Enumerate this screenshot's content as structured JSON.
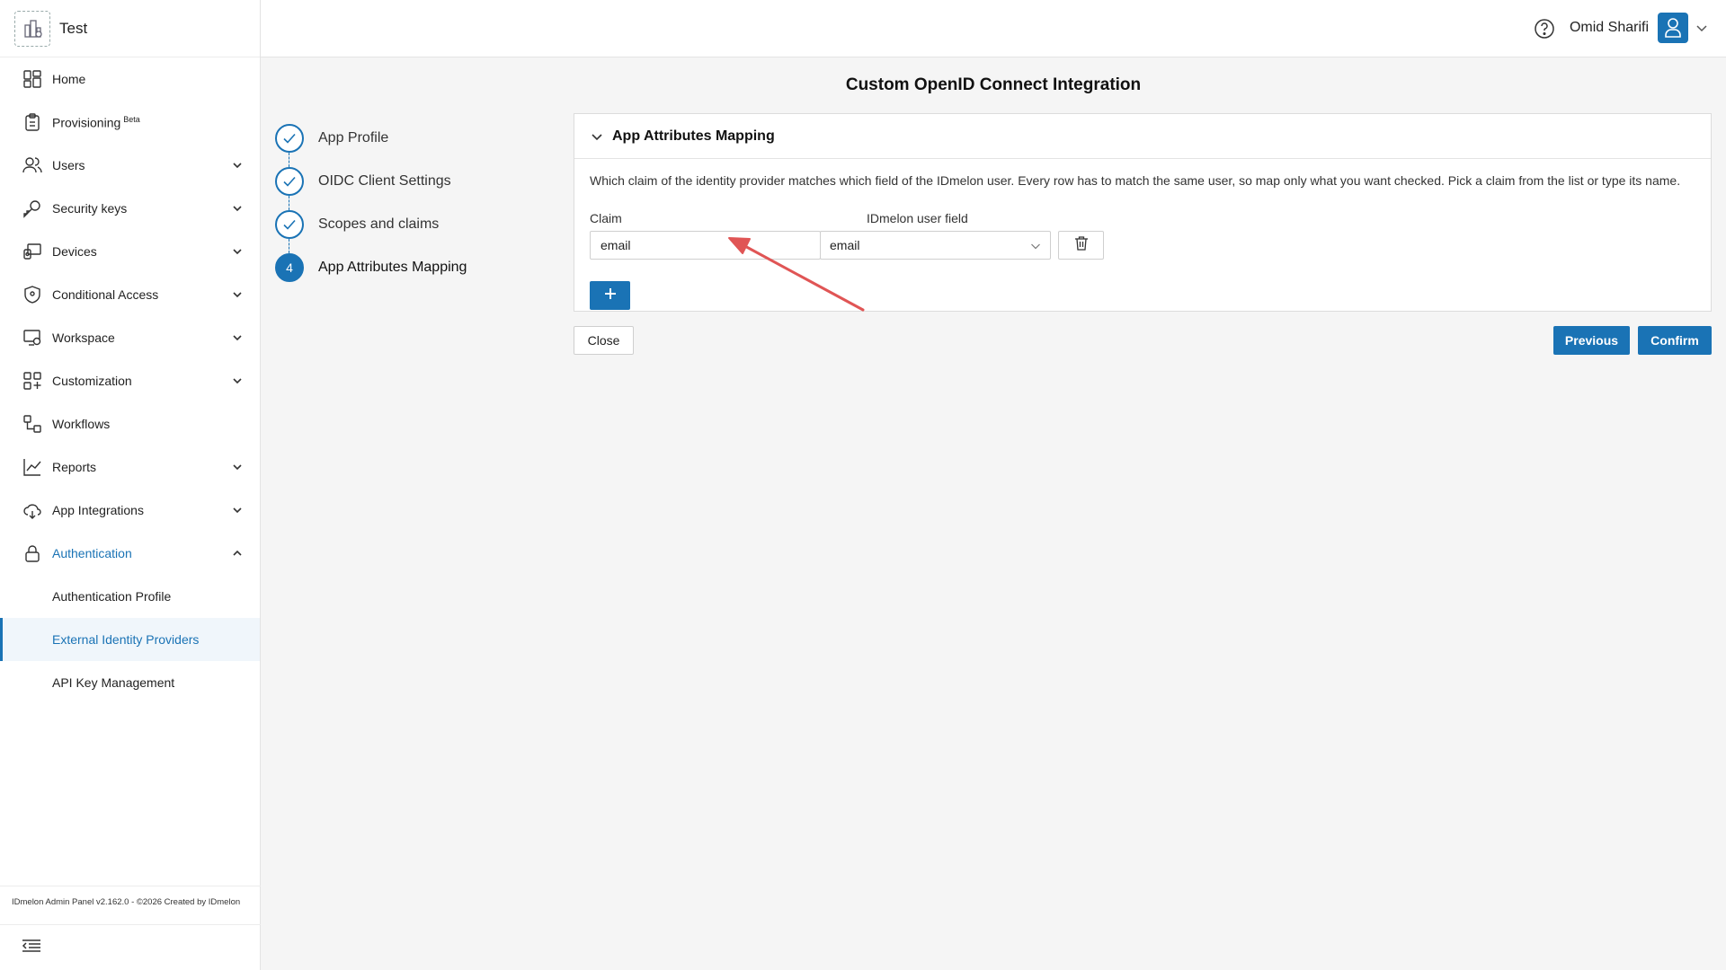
{
  "app": {
    "tenant_name": "Test"
  },
  "header": {
    "user_name": "Omid Sharifi"
  },
  "sidebar": {
    "items": [
      {
        "label": "Home",
        "icon": "home-grid-icon"
      },
      {
        "label": "Provisioning",
        "badge": "Beta",
        "icon": "clipboard-icon"
      },
      {
        "label": "Users",
        "icon": "users-icon"
      },
      {
        "label": "Security keys",
        "icon": "key-icon"
      },
      {
        "label": "Devices",
        "icon": "devices-icon"
      },
      {
        "label": "Conditional Access",
        "icon": "shield-icon"
      },
      {
        "label": "Workspace",
        "icon": "workspace-icon"
      },
      {
        "label": "Customization",
        "icon": "customization-icon"
      },
      {
        "label": "Workflows",
        "icon": "workflows-icon"
      },
      {
        "label": "Reports",
        "icon": "chart-icon"
      },
      {
        "label": "App Integrations",
        "icon": "cloud-icon"
      },
      {
        "label": "Authentication",
        "icon": "lock-icon"
      }
    ],
    "subitems": [
      {
        "label": "Authentication Profile"
      },
      {
        "label": "External Identity Providers"
      },
      {
        "label": "API Key Management"
      }
    ],
    "footer": "IDmelon Admin Panel v2.162.0 - ©2026 Created by IDmelon"
  },
  "page": {
    "title": "Custom OpenID Connect Integration",
    "steps": [
      {
        "label": "App Profile",
        "status": "done"
      },
      {
        "label": "OIDC Client Settings",
        "status": "done"
      },
      {
        "label": "Scopes and claims",
        "status": "done"
      },
      {
        "label": "App Attributes Mapping",
        "status": "current",
        "number": "4"
      }
    ],
    "panel": {
      "title": "App Attributes Mapping",
      "description": "Which claim of the identity provider matches which field of the IDmelon user. Every row has to match the same user, so map only what you want checked. Pick a claim from the list or type its name.",
      "claim_label": "Claim",
      "user_field_label": "IDmelon user field",
      "rows": [
        {
          "claim": "email",
          "user_field": "email"
        }
      ]
    },
    "buttons": {
      "close": "Close",
      "previous": "Previous",
      "confirm": "Confirm"
    }
  },
  "colors": {
    "accent": "#1a73b5",
    "annotation": "#e05555"
  }
}
